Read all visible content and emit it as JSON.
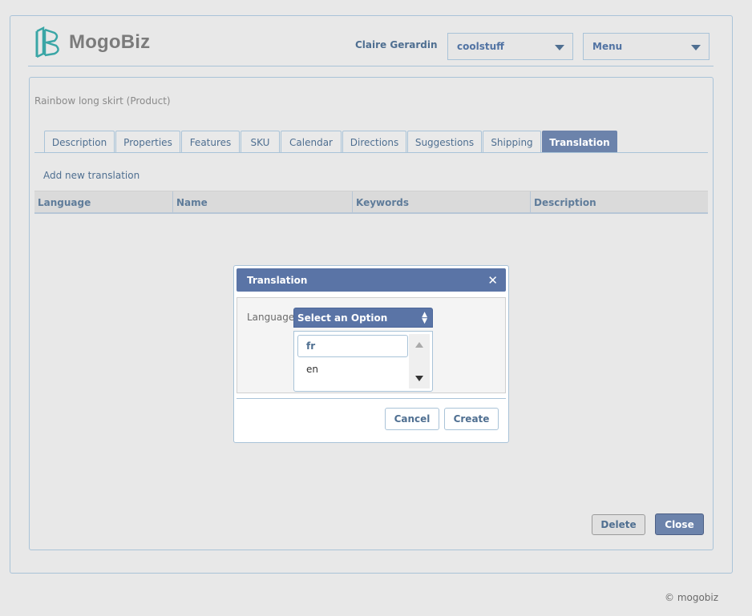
{
  "header": {
    "brand": "MogoBiz",
    "user_name": "Claire Gerardin",
    "store_select": "coolstuff",
    "menu_select": "Menu"
  },
  "product": {
    "title": "Rainbow long skirt (Product)"
  },
  "tabs": [
    {
      "label": "Description"
    },
    {
      "label": "Properties"
    },
    {
      "label": "Features"
    },
    {
      "label": "SKU"
    },
    {
      "label": "Calendar"
    },
    {
      "label": "Directions"
    },
    {
      "label": "Suggestions"
    },
    {
      "label": "Shipping"
    },
    {
      "label": "Translation",
      "active": true
    }
  ],
  "translation_panel": {
    "add_link": "Add new translation",
    "columns": [
      "Language",
      "Name",
      "Keywords",
      "Description"
    ]
  },
  "modal": {
    "title": "Translation",
    "close_icon": "close-icon",
    "language_label": "Language",
    "language_select": "Select an Option",
    "search_value": "fr",
    "options": [
      "en"
    ],
    "cancel_label": "Cancel",
    "create_label": "Create"
  },
  "actions": {
    "delete_label": "Delete",
    "close_label": "Close"
  },
  "footer": {
    "copyright": "© mogobiz"
  },
  "colors": {
    "accent": "#5a74a6",
    "border": "#a9c3d8",
    "text": "#4f6f91"
  }
}
